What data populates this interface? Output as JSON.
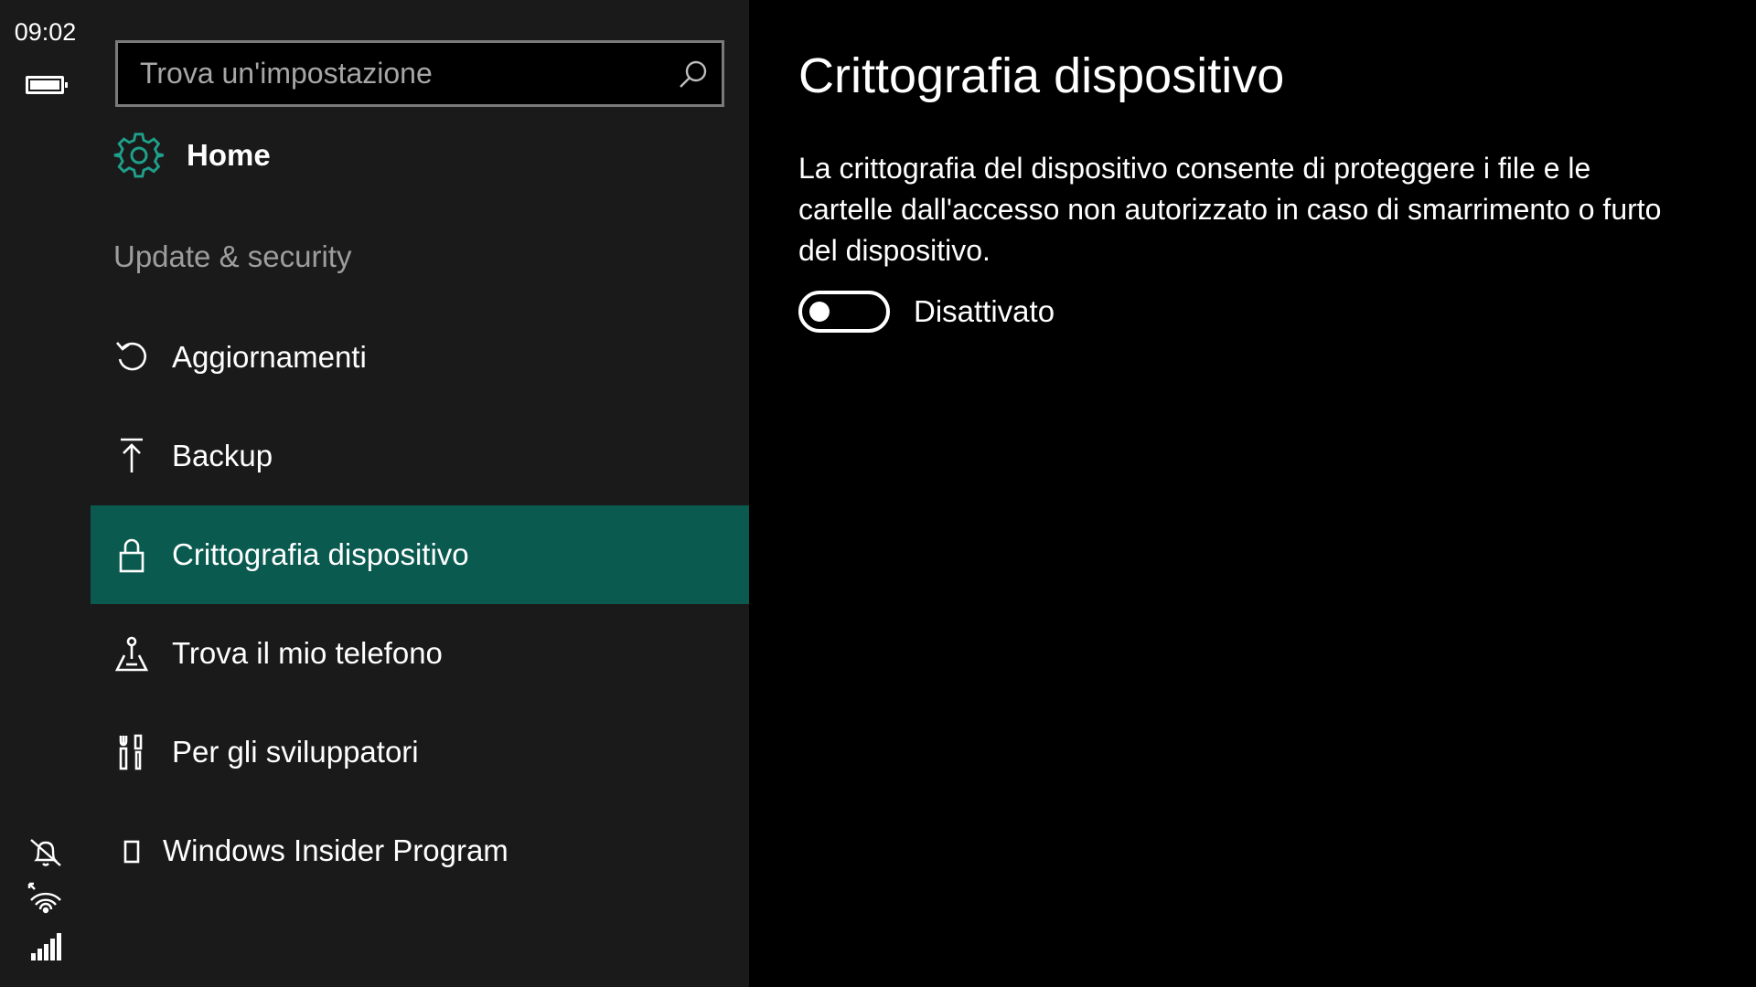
{
  "status_bar": {
    "time": "09:02",
    "battery_icon": "battery-full-icon",
    "icons": [
      "quiet-hours-icon",
      "wifi-icon",
      "cellular-signal-icon"
    ]
  },
  "search": {
    "placeholder": "Trova un'impostazione",
    "value": "",
    "icon": "search-icon"
  },
  "home": {
    "label": "Home",
    "icon": "gear-icon",
    "icon_color": "#1fa08a"
  },
  "section_title": "Update & security",
  "nav_items": [
    {
      "label": "Aggiornamenti",
      "icon": "refresh-icon",
      "selected": false
    },
    {
      "label": "Backup",
      "icon": "upload-icon",
      "selected": false
    },
    {
      "label": "Crittografia dispositivo",
      "icon": "lock-icon",
      "selected": true
    },
    {
      "label": "Trova il mio telefono",
      "icon": "find-phone-icon",
      "selected": false
    },
    {
      "label": "Per gli sviluppatori",
      "icon": "developer-tools-icon",
      "selected": false
    },
    {
      "label": "Windows Insider Program",
      "icon": "phone-outline-icon",
      "selected": false
    }
  ],
  "content": {
    "title": "Crittografia dispositivo",
    "description": "La crittografia del dispositivo consente di proteggere i file e le cartelle dall'accesso non autorizzato in caso di smarrimento o furto del dispositivo.",
    "toggle": {
      "state": false,
      "label": "Disattivato"
    }
  },
  "colors": {
    "accent": "#0a5a50",
    "nav_background": "#1a1a1a",
    "content_background": "#000000",
    "section_title": "#9d9d9d"
  }
}
